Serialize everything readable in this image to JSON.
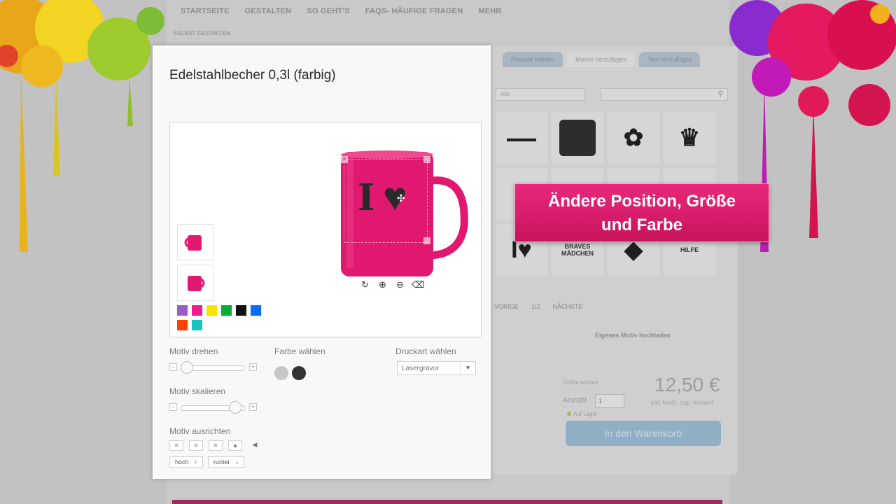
{
  "site": {
    "nav": [
      "STARTSEITE",
      "GESTALTEN",
      "SO GEHT'S",
      "FAQS- HÄUFIGE FRAGEN",
      "MEHR"
    ],
    "breadcrumb": "SELBST GESTALTEN",
    "tabs": [
      "Produkt wählen",
      "Motive hinzufügen",
      "Text hinzufügen"
    ],
    "filter_select": "Alle",
    "motif_text_braves": "BRAVES MÄDCHEN",
    "motif_text_hilfe": "HILFE",
    "pager": [
      "VORIGE",
      "1/2",
      "NÄCHSTE"
    ],
    "upload_label": "Eigenes Motiv hochladen",
    "size_label": "Größe wählen",
    "quantity_label": "Anzahl",
    "quantity_value": "1",
    "stock_label": "Auf Lager",
    "price": "12,50 €",
    "price_note": "inkl. MwSt. zzgl. Versand",
    "cart_button": "In den Warenkorb"
  },
  "modal": {
    "title": "Edelstahlbecher 0,3l (farbig)",
    "motif_text": "I",
    "colors": [
      "#9b59d0",
      "#e91e8c",
      "#f5e400",
      "#00b030",
      "#111111",
      "#0a6cff",
      "#ff4000",
      "#19c3c0"
    ],
    "mug_color": "#e0186f",
    "controls": {
      "rotate_label": "Motiv drehen",
      "rotate_value": 0.1,
      "scale_label": "Motiv skalieren",
      "scale_value": 0.85,
      "align_label": "Motiv ausrichten",
      "color_label": "Farbe wählen",
      "print_label": "Druckart wählen",
      "print_value": "Lasergravur",
      "up_button": "hoch",
      "down_button": "runter"
    }
  },
  "callout": {
    "line1": "Ändere Position, Größe",
    "line2": "und Farbe"
  }
}
